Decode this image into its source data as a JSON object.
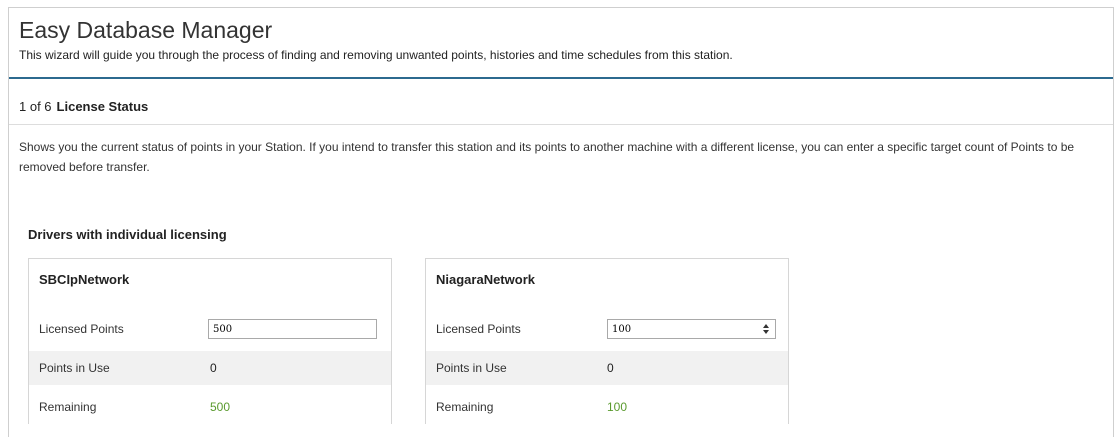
{
  "app": {
    "title": "Easy Database Manager",
    "subtitle": "This wizard will guide you through the process of finding and removing unwanted points, histories and time schedules from this station."
  },
  "step": {
    "progress": "1 of 6",
    "name": "License Status",
    "description": "Shows you the current status of points in your Station. If you intend to transfer this station and its points to another machine with a different license, you can enter a specific target count of Points to be removed before transfer."
  },
  "section": {
    "heading": "Drivers with individual licensing"
  },
  "drivers": [
    {
      "name": "SBCIpNetwork",
      "licensed_label": "Licensed Points",
      "licensed_value": "500",
      "inuse_label": "Points in Use",
      "inuse_value": "0",
      "remaining_label": "Remaining",
      "remaining_value": "500"
    },
    {
      "name": "NiagaraNetwork",
      "licensed_label": "Licensed Points",
      "licensed_value": "100",
      "inuse_label": "Points in Use",
      "inuse_value": "0",
      "remaining_label": "Remaining",
      "remaining_value": "100"
    }
  ],
  "colors": {
    "accent_rule": "#2c6a8f",
    "remaining_text": "#5a9a2e",
    "row_alt_bg": "#f1f1f1"
  },
  "icons": {
    "spinner": "spinner-arrows-icon"
  }
}
